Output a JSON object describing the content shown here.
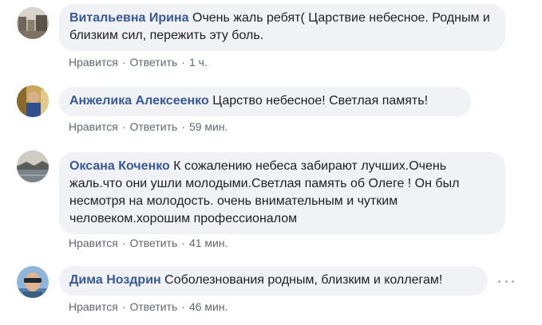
{
  "comments": [
    {
      "author": "Витальевна Ирина",
      "text": "Очень жаль ребят( Царствие небесное. Родным и близким сил, пережить эту боль.",
      "like": "Нравится",
      "reply": "Ответить",
      "time": "1 ч."
    },
    {
      "author": "Анжелика Алексеенко",
      "text": "Царство небесное! Светлая память!",
      "like": "Нравится",
      "reply": "Ответить",
      "time": "59 мин."
    },
    {
      "author": "Оксана Коченко",
      "text": "К сожалению небеса забирают лучших.Очень жаль.что они ушли молодыми.Светлая память об Олеге ! Он был несмотря на молодость. очень внимательным и чутким человеком.хорошим профессионалом",
      "like": "Нравится",
      "reply": "Ответить",
      "time": "41 мин."
    },
    {
      "author": "Дима Ноздрин",
      "text": "Соболезнования родным, близким и коллегам!",
      "like": "Нравится",
      "reply": "Ответить",
      "time": "46 мин."
    }
  ],
  "separator": "·",
  "colors": {
    "author": "#385898",
    "bubble": "#f0f2f5",
    "meta": "#606770",
    "text": "#1c1e21"
  }
}
